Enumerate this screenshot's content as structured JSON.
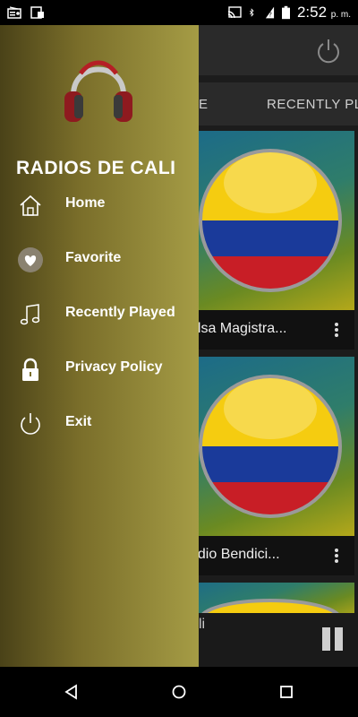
{
  "status_bar": {
    "time": "2:52",
    "ampm": "p. m."
  },
  "app": {
    "tabs": [
      {
        "label": "E"
      },
      {
        "label": "RECENTLY PL"
      }
    ],
    "cards": [
      {
        "title": "alsa Magistra..."
      },
      {
        "title": "adio Bendici..."
      }
    ],
    "mini_player": {
      "title": "li"
    }
  },
  "drawer": {
    "title": "RADIOS DE CALI",
    "items": [
      {
        "label": "Home",
        "icon": "home-icon"
      },
      {
        "label": "Favorite",
        "icon": "heart-icon"
      },
      {
        "label": "Recently Played",
        "icon": "music-note-icon"
      },
      {
        "label": "Privacy Policy",
        "icon": "lock-icon"
      },
      {
        "label": "Exit",
        "icon": "power-icon"
      }
    ]
  },
  "colors": {
    "drawer_gradient_start": "#4a4218",
    "drawer_gradient_end": "#a59c45",
    "flag_yellow": "#f5cc10",
    "flag_blue": "#1a3a9a",
    "flag_red": "#c81e26"
  }
}
